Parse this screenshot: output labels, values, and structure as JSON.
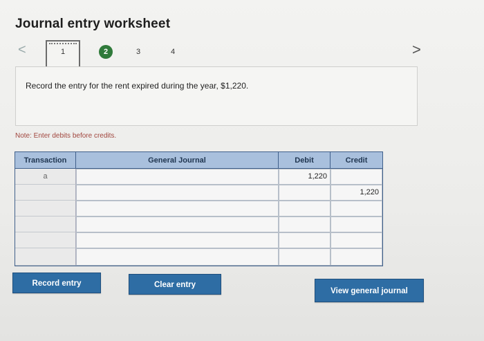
{
  "header": {
    "title": "Journal entry worksheet"
  },
  "steps": [
    {
      "label": "1"
    },
    {
      "label": "2"
    },
    {
      "label": "3"
    },
    {
      "label": "4"
    }
  ],
  "nav": {
    "prev": "<",
    "next": ">"
  },
  "instruction": "Record the entry for the rent expired during the year, $1,220.",
  "note": "Note: Enter debits before credits.",
  "table": {
    "columns": {
      "transaction": "Transaction",
      "journal": "General Journal",
      "debit": "Debit",
      "credit": "Credit"
    },
    "rows": [
      {
        "transaction": "a",
        "account": "",
        "debit": "1,220",
        "credit": ""
      },
      {
        "transaction": "",
        "account": "",
        "debit": "",
        "credit": "1,220"
      },
      {
        "transaction": "",
        "account": "",
        "debit": "",
        "credit": ""
      },
      {
        "transaction": "",
        "account": "",
        "debit": "",
        "credit": ""
      },
      {
        "transaction": "",
        "account": "",
        "debit": "",
        "credit": ""
      },
      {
        "transaction": "",
        "account": "",
        "debit": "",
        "credit": ""
      }
    ]
  },
  "buttons": {
    "record": "Record entry",
    "clear": "Clear entry",
    "view": "View general journal"
  },
  "colors": {
    "accent": "#2e6da4",
    "header_bg": "#a9c0dd",
    "active_step": "#2f7a3a",
    "note": "#a0453d"
  }
}
